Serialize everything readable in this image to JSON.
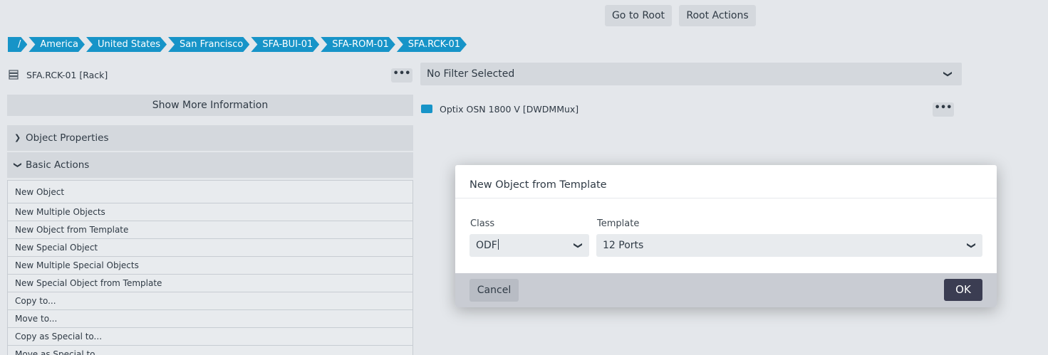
{
  "toolbar": {
    "go_to_root": "Go to Root",
    "root_actions": "Root Actions"
  },
  "breadcrumb": [
    "/",
    "America",
    "United States",
    "San Francisco",
    "SFA-BUI-01",
    "SFA-ROM-01",
    "SFA.RCK-01"
  ],
  "left_panel": {
    "object_title": "SFA.RCK-01 [Rack]",
    "more_label": "•••",
    "show_more": "Show More Information",
    "object_properties": "Object Properties",
    "basic_actions": "Basic Actions",
    "actions": [
      "New Object",
      "New Multiple Objects",
      "New Object from Template",
      "New Special Object",
      "New Multiple Special Objects",
      "New Special Object from Template",
      "Copy to...",
      "Move to...",
      "Copy as Special to...",
      "Move as Special to..."
    ]
  },
  "right_panel": {
    "filter": "No Filter Selected",
    "child_object": "Optix OSN 1800 V [DWDMMux]",
    "more_label": "•••"
  },
  "modal": {
    "title": "New Object from Template",
    "class_label": "Class",
    "class_value": "ODF",
    "template_label": "Template",
    "template_value": "12 Ports",
    "cancel": "Cancel",
    "ok": "OK"
  },
  "colors": {
    "breadcrumb": "#1794c8",
    "ok_button": "#3b3d52",
    "background": "#e4e7eb"
  },
  "icons": {
    "rack": "server-rack-icon",
    "mux": "device-icon",
    "chevron": "chevron-down-icon"
  }
}
